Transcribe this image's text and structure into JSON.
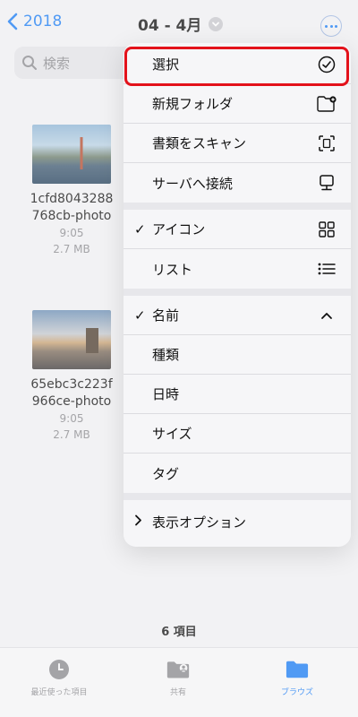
{
  "nav": {
    "back_label": "2018",
    "title": "04 - 4月"
  },
  "search": {
    "placeholder": "検索"
  },
  "files": [
    {
      "name_line1": "1cfd8043288",
      "name_line2": "768cb-photo",
      "time": "9:05",
      "size": "2.7 MB"
    },
    {
      "name_line1": "65ebc3c223f",
      "name_line2": "966ce-photo",
      "time": "9:05",
      "size": "2.7 MB"
    }
  ],
  "item_count": "6 項目",
  "menu": {
    "group1": [
      {
        "label": "選択",
        "icon": "checkmark-circle-icon"
      },
      {
        "label": "新規フォルダ",
        "icon": "folder-plus-icon"
      },
      {
        "label": "書類をスキャン",
        "icon": "scan-icon"
      },
      {
        "label": "サーバへ接続",
        "icon": "server-icon"
      }
    ],
    "group2": [
      {
        "label": "アイコン",
        "checked": true,
        "icon": "grid-icon"
      },
      {
        "label": "リスト",
        "checked": false,
        "icon": "list-icon"
      }
    ],
    "group3": [
      {
        "label": "名前",
        "checked": true,
        "icon": "chevron-up-icon"
      },
      {
        "label": "種類"
      },
      {
        "label": "日時"
      },
      {
        "label": "サイズ"
      },
      {
        "label": "タグ"
      }
    ],
    "options_label": "表示オプション"
  },
  "tabbar": [
    {
      "label": "最近使った項目",
      "icon": "clock-icon"
    },
    {
      "label": "共有",
      "icon": "shared-folder-icon"
    },
    {
      "label": "ブラウズ",
      "icon": "folder-icon",
      "active": true
    }
  ],
  "colors": {
    "accent": "#1a7cf5",
    "highlight": "#e3121b"
  }
}
